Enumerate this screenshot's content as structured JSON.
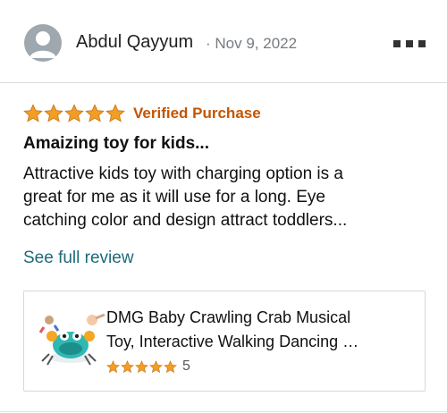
{
  "review": {
    "reviewer_name": "Abdul Qayyum",
    "date": "· Nov 9, 2022",
    "rating": 5,
    "verified_label": "Verified Purchase",
    "title": "Amaizing toy for kids...",
    "text_lines": [
      "Attractive kids toy with charging option is a",
      "great for me as it will use for a long. Eye",
      "catching color and design attract toddlers..."
    ],
    "see_full_label": "See full review"
  },
  "product": {
    "name_lines": [
      "DMG Baby Crawling Crab Musical",
      "Toy, Interactive Walking Dancing …"
    ],
    "rating": 5,
    "rating_count": "5"
  },
  "colors": {
    "star": "#f29d24",
    "verified": "#c45500",
    "link": "#1d6a7a",
    "avatar": "#9ea8ae"
  },
  "icons": {
    "avatar": "user-avatar-icon",
    "more": "more-options-icon",
    "star": "star-icon"
  }
}
